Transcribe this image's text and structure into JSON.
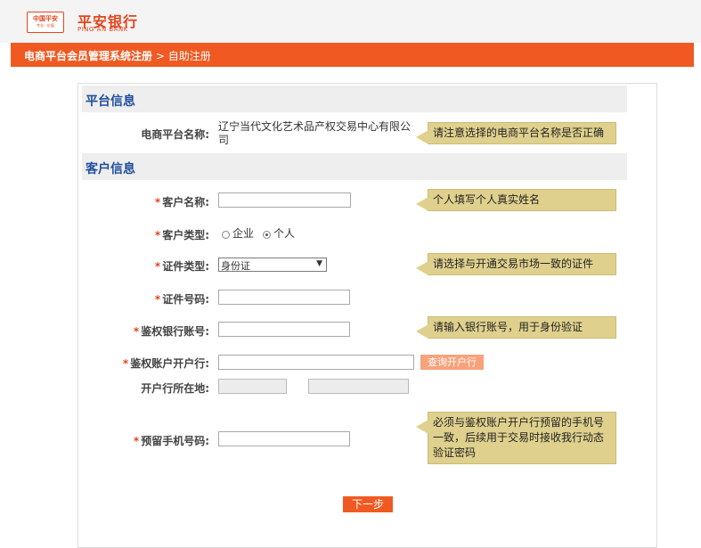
{
  "header": {
    "logo_text": "中国平安",
    "logo_slogan": "专业 · 价值",
    "bank_name": "平安银行",
    "bank_name_en": "PING AN BANK"
  },
  "nav": {
    "system": "电商平台会员管理系统注册",
    "separator": " > ",
    "current": "自助注册"
  },
  "sections": {
    "platform": "平台信息",
    "customer": "客户信息"
  },
  "platform": {
    "name_label": "电商平台名称:",
    "name_value": "辽宁当代文化艺术品产权交易中心有限公司",
    "name_tip": "请注意选择的电商平台名称是否正确"
  },
  "form": {
    "required_mark": "*",
    "customer_name": {
      "label": "客户名称:",
      "value": "",
      "tip": "个人填写个人真实姓名"
    },
    "customer_type": {
      "label": "客户类型:",
      "options": [
        "企业",
        "个人"
      ],
      "selected": "个人"
    },
    "id_type": {
      "label": "证件类型:",
      "value": "身份证",
      "tip": "请选择与开通交易市场一致的证件"
    },
    "id_number": {
      "label": "证件号码:",
      "value": ""
    },
    "bank_account": {
      "label": "鉴权银行账号:",
      "value": "",
      "tip": "请输入银行账号，用于身份验证"
    },
    "account_bank": {
      "label": "鉴权账户开户行:",
      "value": "",
      "button": "查询开户行"
    },
    "bank_location": {
      "label": "开户行所在地:",
      "province": "",
      "city": ""
    },
    "phone": {
      "label": "预留手机号码:",
      "value": "",
      "tip": "必须与鉴权账户开户行预留的手机号一致，后续用于交易时接收我行动态验证密码"
    }
  },
  "actions": {
    "next": "下一步"
  },
  "colors": {
    "brand": "#f05a22",
    "section_title": "#1f4e9d",
    "tip_bg": "#dfd18d"
  }
}
